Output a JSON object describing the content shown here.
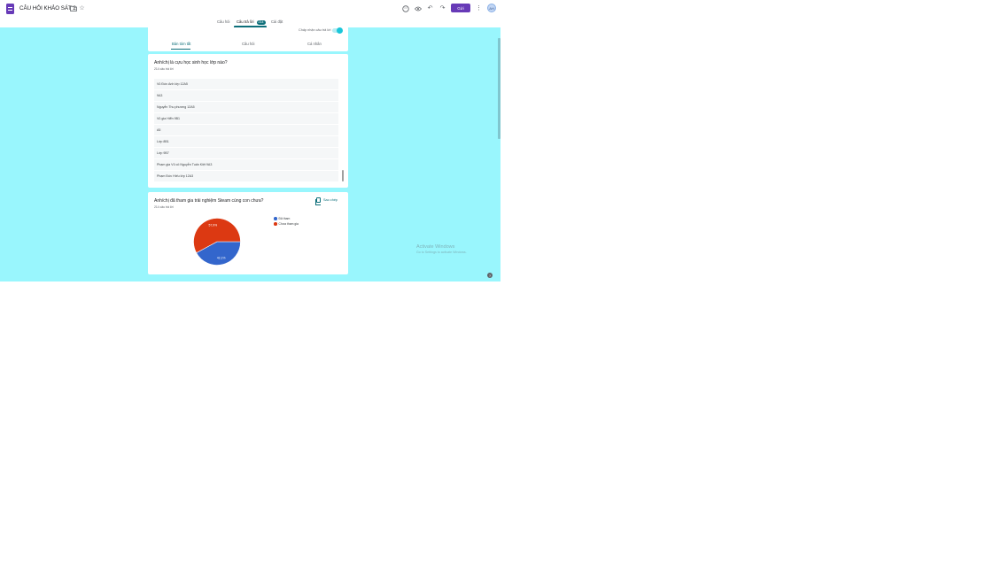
{
  "header": {
    "title": "CÂU HỎI KHẢO SÁT 2",
    "send_label": "Gửi",
    "avatar_initials": "AH"
  },
  "main_tabs": {
    "questions": "Câu hỏi",
    "responses": "Câu trả lời",
    "response_count": "214",
    "settings": "Cài đặt"
  },
  "summary": {
    "accepting_label": "Chấp nhận câu trả lời",
    "accepting": true,
    "tabs": [
      "Bản tóm tắt",
      "Câu hỏi",
      "Cá nhân"
    ]
  },
  "question1": {
    "title": "Anh/chị là cựu học sinh học lớp nào?",
    "count": "214 câu trả lời",
    "responses": [
      "Vũ Đức Anh lớp 12A5",
      "9A3",
      "Nguyễn Thu phương 12A5",
      "Vũ gia Hiển 9B1",
      "A5",
      "Lớp 8B1",
      "Lớp 9B7",
      "Phạm gia Vũ cô Nguyễn Tuấn Kiệt 9A3",
      "Phạm Đức Hiếu lớp 12A3"
    ]
  },
  "question2": {
    "title": "Anh/chị đã tham gia trải nghiệm Steam cùng con chưa?",
    "count": "214 câu trả lời",
    "copy_label": "Sao chép"
  },
  "chart_data": {
    "type": "pie",
    "series": [
      {
        "name": "Đã tham",
        "value": 42.1,
        "color": "#3366cc"
      },
      {
        "name": "Chưa tham gia",
        "value": 57.9,
        "color": "#dc3912"
      }
    ],
    "labels": [
      "42,1%",
      "57,9%"
    ],
    "legend_position": "right"
  },
  "watermark": {
    "line1": "Activate Windows",
    "line2": "Go to Settings to activate Windows."
  },
  "help_label": "?"
}
